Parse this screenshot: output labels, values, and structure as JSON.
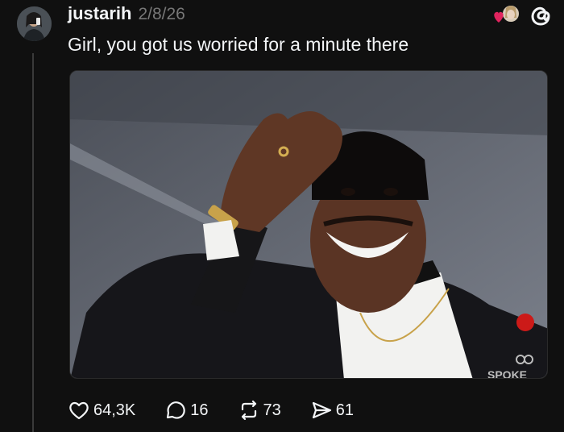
{
  "post": {
    "username": "justarih",
    "date": "2/8/26",
    "text": "Girl, you got us worried for a minute there"
  },
  "media": {
    "watermark": "SPOKE"
  },
  "actions": {
    "likes": "64,3K",
    "replies": "16",
    "reposts": "73",
    "shares": "61"
  },
  "colors": {
    "background": "#101010",
    "heart": "#e0245e",
    "muted": "#777777"
  }
}
